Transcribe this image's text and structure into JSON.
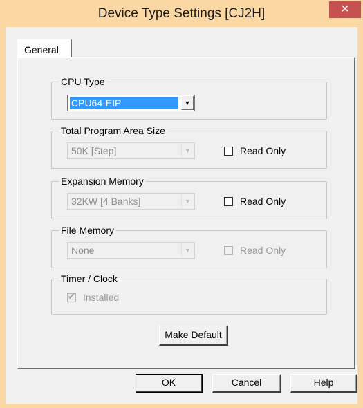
{
  "window": {
    "title": "Device Type Settings [CJ2H]",
    "close_glyph": "✕"
  },
  "tabs": [
    {
      "label": "General",
      "selected": true
    }
  ],
  "groups": {
    "cpu_type": {
      "label": "CPU Type",
      "value": "CPU64-EIP"
    },
    "program_area": {
      "label": "Total Program Area Size",
      "value": "50K [Step]",
      "checkbox_label": "Read Only",
      "checked": false
    },
    "expansion_memory": {
      "label": "Expansion Memory",
      "value": "32KW [4 Banks]",
      "checkbox_label": "Read Only",
      "checked": false
    },
    "file_memory": {
      "label": "File Memory",
      "value": "None",
      "checkbox_label": "Read Only",
      "checked": false
    },
    "timer_clock": {
      "label": "Timer / Clock",
      "checkbox_label": "Installed",
      "checked": true
    }
  },
  "buttons": {
    "make_default": "Make Default",
    "ok": "OK",
    "cancel": "Cancel",
    "help": "Help"
  },
  "icons": {
    "dropdown": "chevron-down-icon",
    "checkmark": "checkmark-icon"
  },
  "colors": {
    "selection": "#3399ff",
    "title_frame": "#fbd7a4",
    "close": "#c75050"
  }
}
